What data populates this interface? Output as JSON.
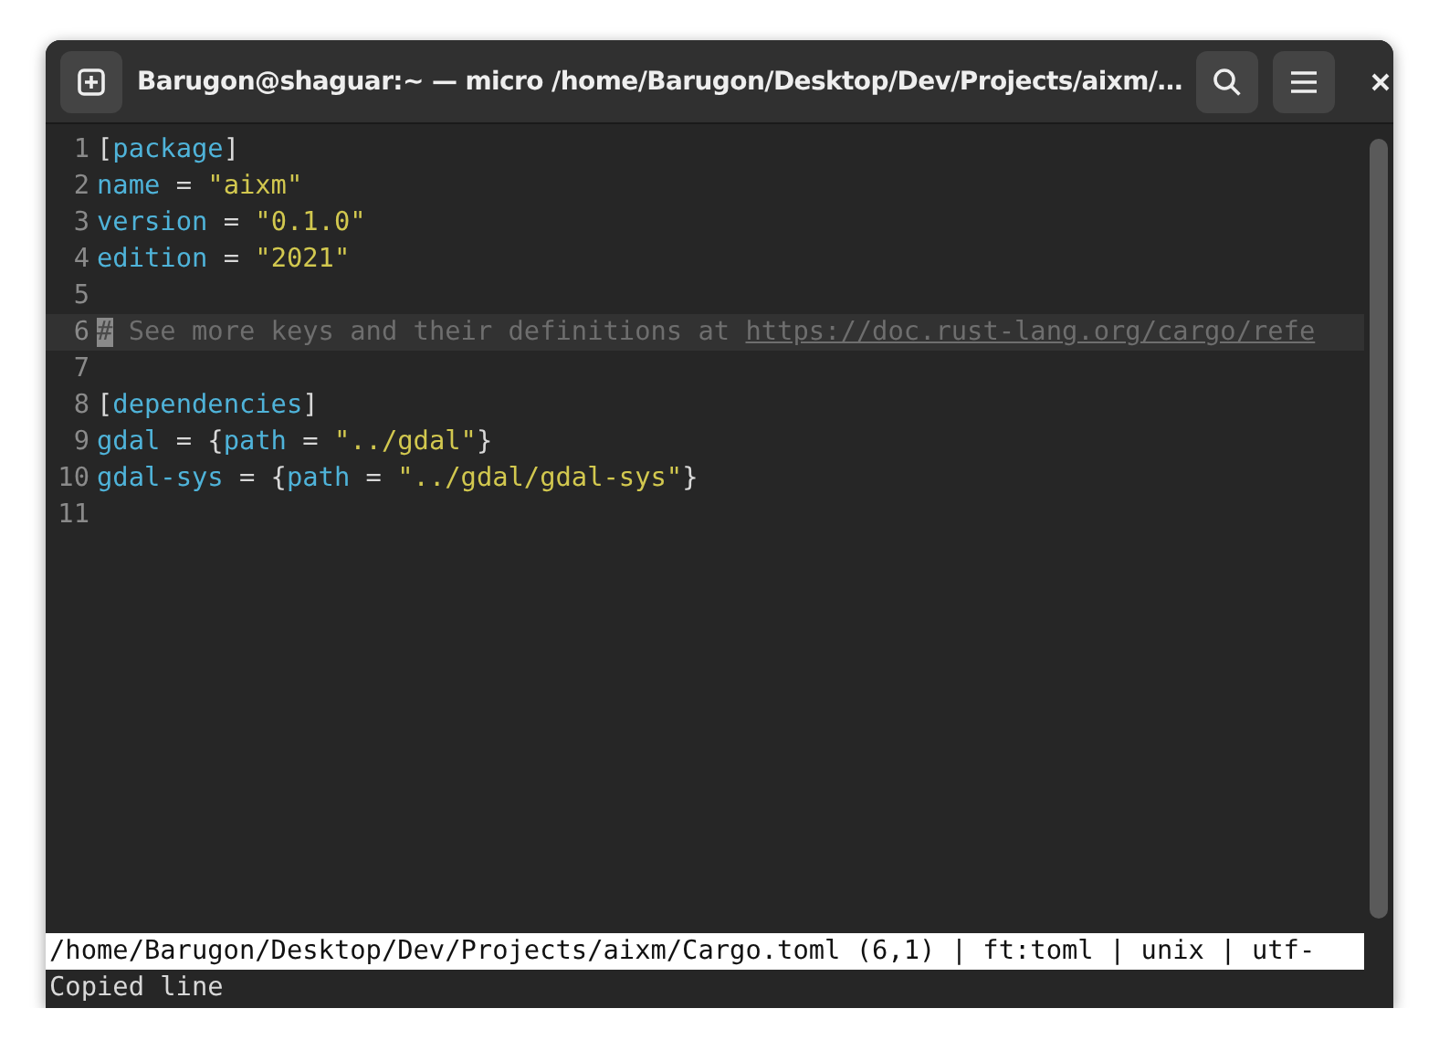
{
  "window": {
    "title": "Barugon@shaguar:~ — micro /home/Barugon/Desktop/Dev/Projects/aixm/…"
  },
  "editor": {
    "lines": [
      {
        "number": "1",
        "selected": false,
        "tokens": [
          {
            "kind": "plain",
            "text": "["
          },
          {
            "kind": "key",
            "text": "package"
          },
          {
            "kind": "plain",
            "text": "]"
          }
        ]
      },
      {
        "number": "2",
        "selected": false,
        "tokens": [
          {
            "kind": "key",
            "text": "name"
          },
          {
            "kind": "plain",
            "text": " = "
          },
          {
            "kind": "string",
            "text": "\"aixm\""
          }
        ]
      },
      {
        "number": "3",
        "selected": false,
        "tokens": [
          {
            "kind": "key",
            "text": "version"
          },
          {
            "kind": "plain",
            "text": " = "
          },
          {
            "kind": "string",
            "text": "\"0.1.0\""
          }
        ]
      },
      {
        "number": "4",
        "selected": false,
        "tokens": [
          {
            "kind": "key",
            "text": "edition"
          },
          {
            "kind": "plain",
            "text": " = "
          },
          {
            "kind": "string",
            "text": "\"2021\""
          }
        ]
      },
      {
        "number": "5",
        "selected": false
      },
      {
        "number": "6",
        "selected": true,
        "tokens": [
          {
            "kind": "cursor",
            "text": "#"
          },
          {
            "kind": "comment",
            "text": " See more keys and their definitions at "
          },
          {
            "kind": "link",
            "text": "https://doc.rust-lang.org/cargo/refe"
          }
        ]
      },
      {
        "number": "7",
        "selected": false
      },
      {
        "number": "8",
        "selected": false,
        "tokens": [
          {
            "kind": "plain",
            "text": "["
          },
          {
            "kind": "key",
            "text": "dependencies"
          },
          {
            "kind": "plain",
            "text": "]"
          }
        ]
      },
      {
        "number": "9",
        "selected": false,
        "tokens": [
          {
            "kind": "key",
            "text": "gdal"
          },
          {
            "kind": "plain",
            "text": " = {"
          },
          {
            "kind": "key",
            "text": "path"
          },
          {
            "kind": "plain",
            "text": " = "
          },
          {
            "kind": "string",
            "text": "\"../gdal\""
          },
          {
            "kind": "plain",
            "text": "}"
          }
        ]
      },
      {
        "number": "10",
        "selected": false,
        "tokens": [
          {
            "kind": "key",
            "text": "gdal-sys"
          },
          {
            "kind": "plain",
            "text": " = {"
          },
          {
            "kind": "key",
            "text": "path"
          },
          {
            "kind": "plain",
            "text": " = "
          },
          {
            "kind": "string",
            "text": "\"../gdal/gdal-sys\""
          },
          {
            "kind": "plain",
            "text": "}"
          }
        ]
      },
      {
        "number": "11",
        "selected": false
      }
    ]
  },
  "status_bar": {
    "text": "/home/Barugon/Desktop/Dev/Projects/aixm/Cargo.toml (6,1) | ft:toml | unix | utf-"
  },
  "message": {
    "text": "Copied line"
  }
}
